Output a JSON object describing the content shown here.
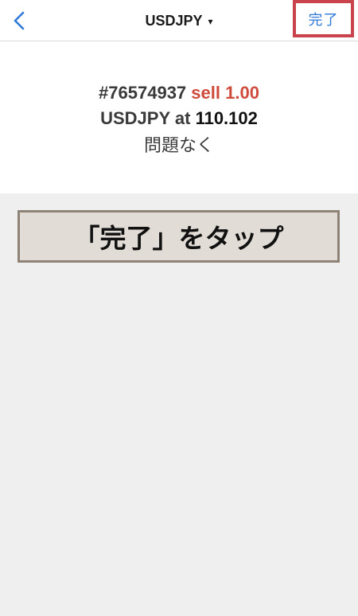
{
  "nav": {
    "title": "USDJPY",
    "title_caret": "▾",
    "done_label": "完了",
    "back_icon": "chevron-left-icon"
  },
  "result": {
    "ticket": "#76574937",
    "side": "sell",
    "volume": "1.00",
    "symbol": "USDJPY",
    "at_word": "at",
    "price": "110.102",
    "status": "問題なく"
  },
  "instruction": {
    "text": "「完了」をタップ"
  },
  "colors": {
    "accent_blue": "#2f79d8",
    "sell_red": "#d04a3c",
    "highlight_border": "#c9434c",
    "instruction_bg": "#e2dcd7",
    "instruction_border": "#8f8378"
  }
}
